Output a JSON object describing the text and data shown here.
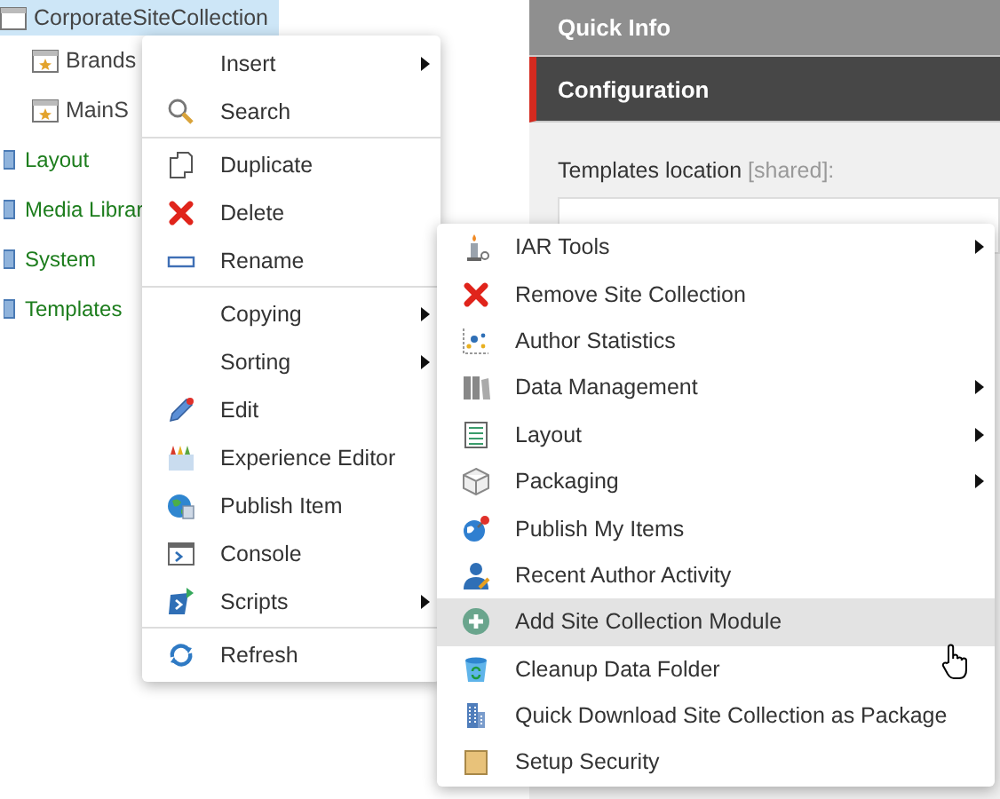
{
  "tree": [
    {
      "label": "CorporateSiteCollection",
      "kind": "site",
      "selected": true,
      "children": [
        {
          "label": "Brands",
          "kind": "site",
          "selected": false
        },
        {
          "label": "MainS",
          "kind": "site",
          "selected": false
        }
      ]
    },
    {
      "label": "Layout",
      "kind": "folder",
      "selected": false
    },
    {
      "label": "Media Librar",
      "kind": "folder",
      "selected": false
    },
    {
      "label": "System",
      "kind": "folder",
      "selected": false
    },
    {
      "label": "Templates",
      "kind": "folder",
      "selected": false
    }
  ],
  "panel": {
    "sections": [
      {
        "title": "Quick Info",
        "active": false
      },
      {
        "title": "Configuration",
        "active": true
      }
    ],
    "field_label": "Templates location",
    "field_note": "[shared]:"
  },
  "context_menu": [
    {
      "kind": "item",
      "label": "Insert",
      "submenu": true
    },
    {
      "kind": "item",
      "label": "Search",
      "submenu": false
    },
    {
      "kind": "separator"
    },
    {
      "kind": "item",
      "label": "Duplicate",
      "submenu": false
    },
    {
      "kind": "item",
      "label": "Delete",
      "submenu": false
    },
    {
      "kind": "item",
      "label": "Rename",
      "submenu": false
    },
    {
      "kind": "separator"
    },
    {
      "kind": "item",
      "label": "Copying",
      "submenu": true
    },
    {
      "kind": "item",
      "label": "Sorting",
      "submenu": true
    },
    {
      "kind": "item",
      "label": "Edit",
      "submenu": false
    },
    {
      "kind": "item",
      "label": "Experience Editor",
      "submenu": false
    },
    {
      "kind": "item",
      "label": "Publish Item",
      "submenu": false
    },
    {
      "kind": "item",
      "label": "Console",
      "submenu": false
    },
    {
      "kind": "item",
      "label": "Scripts",
      "submenu": true
    },
    {
      "kind": "separator"
    },
    {
      "kind": "item",
      "label": "Refresh",
      "submenu": false
    }
  ],
  "submenu": [
    {
      "label": "IAR Tools",
      "submenu": true,
      "hovered": false
    },
    {
      "label": "Remove Site Collection",
      "submenu": false,
      "hovered": false
    },
    {
      "label": "Author Statistics",
      "submenu": false,
      "hovered": false
    },
    {
      "label": "Data Management",
      "submenu": true,
      "hovered": false
    },
    {
      "label": "Layout",
      "submenu": true,
      "hovered": false
    },
    {
      "label": "Packaging",
      "submenu": true,
      "hovered": false
    },
    {
      "label": "Publish My Items",
      "submenu": false,
      "hovered": false
    },
    {
      "label": "Recent Author Activity",
      "submenu": false,
      "hovered": false
    },
    {
      "label": "Add Site Collection Module",
      "submenu": false,
      "hovered": true
    },
    {
      "label": "Cleanup Data Folder",
      "submenu": false,
      "hovered": false
    },
    {
      "label": "Quick Download Site Collection as Package",
      "submenu": false,
      "hovered": false
    },
    {
      "label": "Setup Security",
      "submenu": false,
      "hovered": false
    }
  ]
}
